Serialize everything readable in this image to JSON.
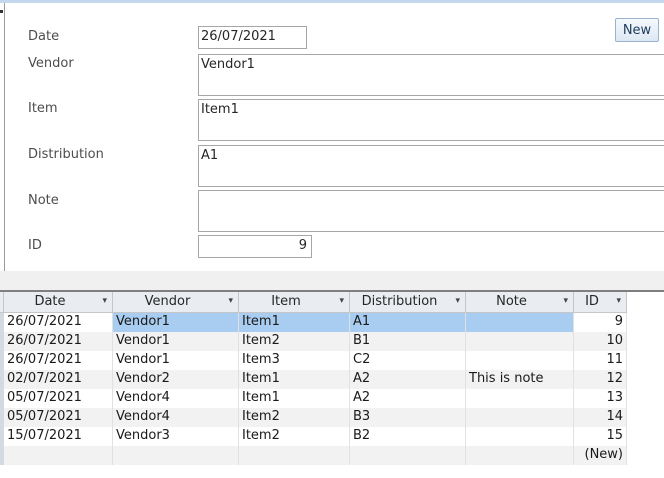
{
  "form": {
    "labels": {
      "date": "Date",
      "vendor": "Vendor",
      "item": "Item",
      "distribution": "Distribution",
      "note": "Note",
      "id": "ID"
    },
    "values": {
      "date": "26/07/2021",
      "vendor": "Vendor1",
      "item": "Item1",
      "distribution": "A1",
      "note": "",
      "id": "9"
    },
    "new_button": "New"
  },
  "grid": {
    "columns": [
      "Date",
      "Vendor",
      "Item",
      "Distribution",
      "Note",
      "ID"
    ],
    "rows": [
      [
        "26/07/2021",
        "Vendor1",
        "Item1",
        "A1",
        "",
        "9"
      ],
      [
        "26/07/2021",
        "Vendor1",
        "Item2",
        "B1",
        "",
        "10"
      ],
      [
        "26/07/2021",
        "Vendor1",
        "Item3",
        "C2",
        "",
        "11"
      ],
      [
        "02/07/2021",
        "Vendor2",
        "Item1",
        "A2",
        "This is note",
        "12"
      ],
      [
        "05/07/2021",
        "Vendor4",
        "Item1",
        "A2",
        "",
        "13"
      ],
      [
        "05/07/2021",
        "Vendor4",
        "Item2",
        "B3",
        "",
        "14"
      ],
      [
        "15/07/2021",
        "Vendor3",
        "Item2",
        "B2",
        "",
        "15"
      ]
    ],
    "new_row_label": "(New)",
    "selected_row": 0,
    "selected_columns": [
      1,
      2,
      3,
      4
    ],
    "colors": {
      "selection": "#a9cdf0",
      "alt_row": "#f2f2f2",
      "header": "#e9edf1"
    }
  }
}
